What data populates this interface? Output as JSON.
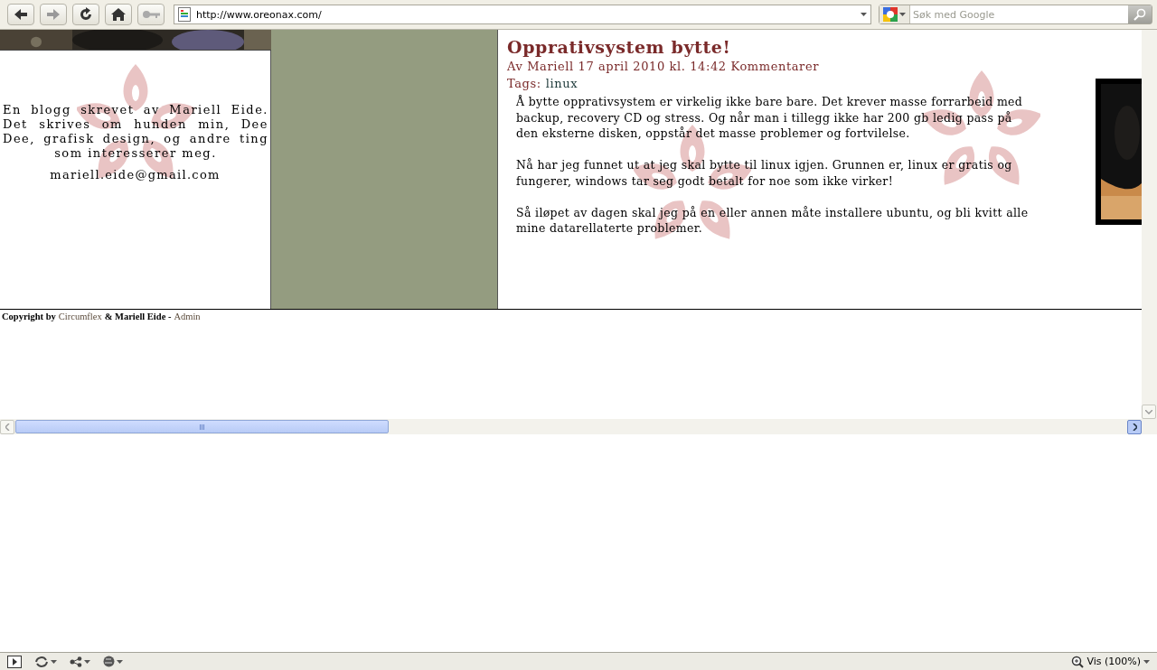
{
  "toolbar": {
    "url": "http://www.oreonax.com/",
    "search": {
      "placeholder": "Søk med Google"
    }
  },
  "sidebar": {
    "description": "En blogg skrevet av Mariell Eide. Det skrives om hunden min, Dee Dee, grafisk design, og andre ting som interesserer meg.",
    "email": "mariell.eide@gmail.com"
  },
  "post": {
    "title": "Opprativsystem bytte!",
    "meta": "Av Mariell 17 april 2010 kl. 14:42 Kommentarer",
    "tags_label": "Tags:",
    "tags": [
      "linux"
    ],
    "paragraphs": [
      "Å bytte opprativsystem er virkelig ikke bare bare. Det krever masse forrarbeid med backup, recovery CD og stress. Og når man i tillegg ikke har 200 gb ledig pass på den eksterne disken, oppstår det masse problemer og fortvilelse.",
      "Nå har jeg funnet ut at jeg skal bytte til linux igjen. Grunnen er, linux er gratis og fungerer, windows tar seg godt betalt for noe som ikke virker!",
      "Så iløpet av dagen skal jeg på en eller annen måte installere ubuntu, og bli kvitt alle mine datarellaterte problemer."
    ]
  },
  "footer": [
    {
      "kind": "text",
      "text": "Copyright by"
    },
    {
      "kind": "link",
      "text": "Circumflex"
    },
    {
      "kind": "text",
      "text": "& Mariell Eide -"
    },
    {
      "kind": "link",
      "text": "Admin"
    }
  ],
  "status_bar": {
    "zoom": "Vis (100%)"
  }
}
